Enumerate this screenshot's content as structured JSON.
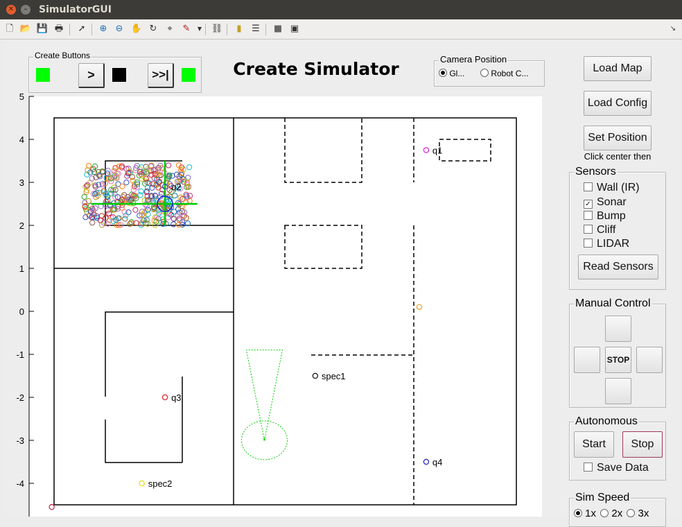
{
  "window": {
    "title": "SimulatorGUI"
  },
  "toolbar": {
    "icons": [
      "new-file-icon",
      "open-folder-icon",
      "save-icon",
      "print-icon",
      "pointer-icon",
      "zoom-in-icon",
      "zoom-out-icon",
      "pan-hand-icon",
      "rotate-icon",
      "data-cursor-icon",
      "brush-icon",
      "link-icon",
      "colorbar-icon",
      "legend-icon",
      "hide-plot-tools-icon",
      "show-plot-tools-icon",
      "dock-icon"
    ]
  },
  "create_buttons": {
    "title": "Create Buttons",
    "play_label": ">",
    "ffwd_label": ">>|",
    "led_color": "#00ff00"
  },
  "heading": {
    "text": "Create Simulator"
  },
  "camera": {
    "title": "Camera Position",
    "opt_global": "Gl...",
    "opt_robot": "Robot C..."
  },
  "right": {
    "load_map": "Load Map",
    "load_config": "Load Config",
    "set_position": "Set Position",
    "hint": "Click center then",
    "sensors_title": "Sensors",
    "sensors": [
      {
        "label": "Wall (IR)",
        "checked": false
      },
      {
        "label": "Sonar",
        "checked": true
      },
      {
        "label": "Bump",
        "checked": false
      },
      {
        "label": "Cliff",
        "checked": false
      },
      {
        "label": "LIDAR",
        "checked": false
      }
    ],
    "read_sensors": "Read Sensors",
    "manual_title": "Manual Control",
    "stop_label": "STOP",
    "auto_title": "Autonomous",
    "start_label": "Start",
    "auto_stop_label": "Stop",
    "save_data": "Save Data",
    "sim_speed_title": "Sim Speed",
    "speeds": [
      "1x",
      "2x",
      "3x"
    ],
    "speed_selected": "1x"
  },
  "chart_data": {
    "type": "scatter",
    "title": "",
    "xlabel": "",
    "ylabel": "",
    "xlim": [
      -5,
      5
    ],
    "ylim": [
      -4.6,
      5
    ],
    "y_ticks": [
      -4,
      -3,
      -2,
      -1,
      0,
      1,
      2,
      3,
      4,
      5
    ],
    "points": [
      {
        "label": "q1",
        "x": 3.05,
        "y": 3.75,
        "color": "#e020e0"
      },
      {
        "label": "q2",
        "x": -2.6,
        "y": 2.9,
        "color": "#3050c0"
      },
      {
        "label": "q3",
        "x": -2.6,
        "y": -2.0,
        "color": "#e02020"
      },
      {
        "label": "q4",
        "x": 3.05,
        "y": -3.5,
        "color": "#2020c0"
      },
      {
        "label": "spec1",
        "x": 0.65,
        "y": -1.5,
        "color": "#111111"
      },
      {
        "label": "spec2",
        "x": -3.1,
        "y": -4.0,
        "color": "#e0e020"
      },
      {
        "label": "",
        "x": 2.9,
        "y": 0.1,
        "color": "#e8a020"
      },
      {
        "label": "",
        "x": -5.05,
        "y": -4.55,
        "color": "#c02040"
      }
    ],
    "robot": {
      "x": -2.6,
      "y": 2.5
    },
    "second_robot": {
      "x": -0.45,
      "y": -3.0
    },
    "particle_cloud": {
      "xrange": [
        -4.35,
        -2.05
      ],
      "yrange": [
        2.0,
        3.4
      ],
      "count": 380
    }
  }
}
